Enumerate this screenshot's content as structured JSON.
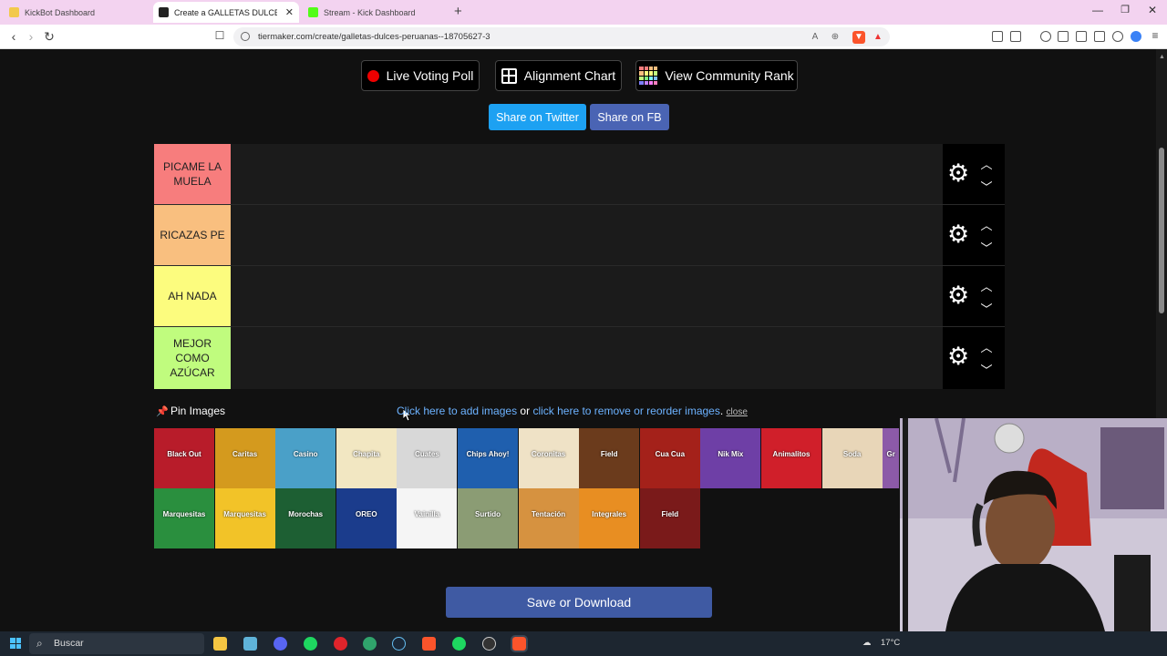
{
  "browser": {
    "tabs": [
      {
        "title": "KickBot Dashboard",
        "color": "#f2c94c",
        "active": false
      },
      {
        "title": "Create a GALLETAS DULCES PERU",
        "color": "#222222",
        "active": true
      },
      {
        "title": "Stream - Kick Dashboard",
        "color": "#53fc18",
        "active": false
      }
    ],
    "url": "tiermaker.com/create/galletas-dulces-peruanas--18705627-3"
  },
  "toolbar": {
    "live_voting": "Live Voting Poll",
    "alignment_chart": "Alignment Chart",
    "community_rank": "View Community Rank",
    "share_twitter": "Share on Twitter",
    "share_fb": "Share on FB"
  },
  "tiers": [
    {
      "label": "PICAME LA MUELA",
      "color": "#f77d7d"
    },
    {
      "label": "RICAZAS PE",
      "color": "#f9bf7f"
    },
    {
      "label": "AH NADA",
      "color": "#fcfc7e"
    },
    {
      "label": "MEJOR COMO AZÚCAR",
      "color": "#c0fc7e"
    }
  ],
  "pool": {
    "pin_label": "Pin Images",
    "add_link": "Click here to add images",
    "or": "or",
    "reorder_link": "click here to remove or reorder images",
    "close": "close",
    "items": [
      {
        "name": "Black Out",
        "color": "#b81c2a"
      },
      {
        "name": "Caritas",
        "color": "#d49a1e"
      },
      {
        "name": "Casino",
        "color": "#4aa0c8"
      },
      {
        "name": "Chapita",
        "color": "#f2e7c2"
      },
      {
        "name": "Cuates",
        "color": "#d8d8d8"
      },
      {
        "name": "Chips Ahoy!",
        "color": "#1f5fae"
      },
      {
        "name": "Coronitas",
        "color": "#efe2c6"
      },
      {
        "name": "Field",
        "color": "#6b3b1c"
      },
      {
        "name": "Cua Cua",
        "color": "#a4211a"
      },
      {
        "name": "Nik Mix",
        "color": "#6e3fa6"
      },
      {
        "name": "Animalitos",
        "color": "#d01f2a"
      },
      {
        "name": "Soda",
        "color": "#e8d6b8"
      },
      {
        "name": "Gr",
        "color": "#8c5aa8"
      },
      {
        "name": "Marquesitas",
        "color": "#2a8f3e"
      },
      {
        "name": "Marquesitas",
        "color": "#f2c328"
      },
      {
        "name": "Morochas",
        "color": "#1d5f33"
      },
      {
        "name": "OREO",
        "color": "#1b3c8c"
      },
      {
        "name": "Vainilla",
        "color": "#f5f5f5"
      },
      {
        "name": "Surtido",
        "color": "#8b9c74"
      },
      {
        "name": "Tentación",
        "color": "#d69240"
      },
      {
        "name": "Integrales",
        "color": "#e88e22"
      },
      {
        "name": "Field",
        "color": "#7a1a1a"
      }
    ]
  },
  "save_button": "Save or Download",
  "taskbar": {
    "search_placeholder": "Buscar",
    "temperature": "17°C"
  }
}
